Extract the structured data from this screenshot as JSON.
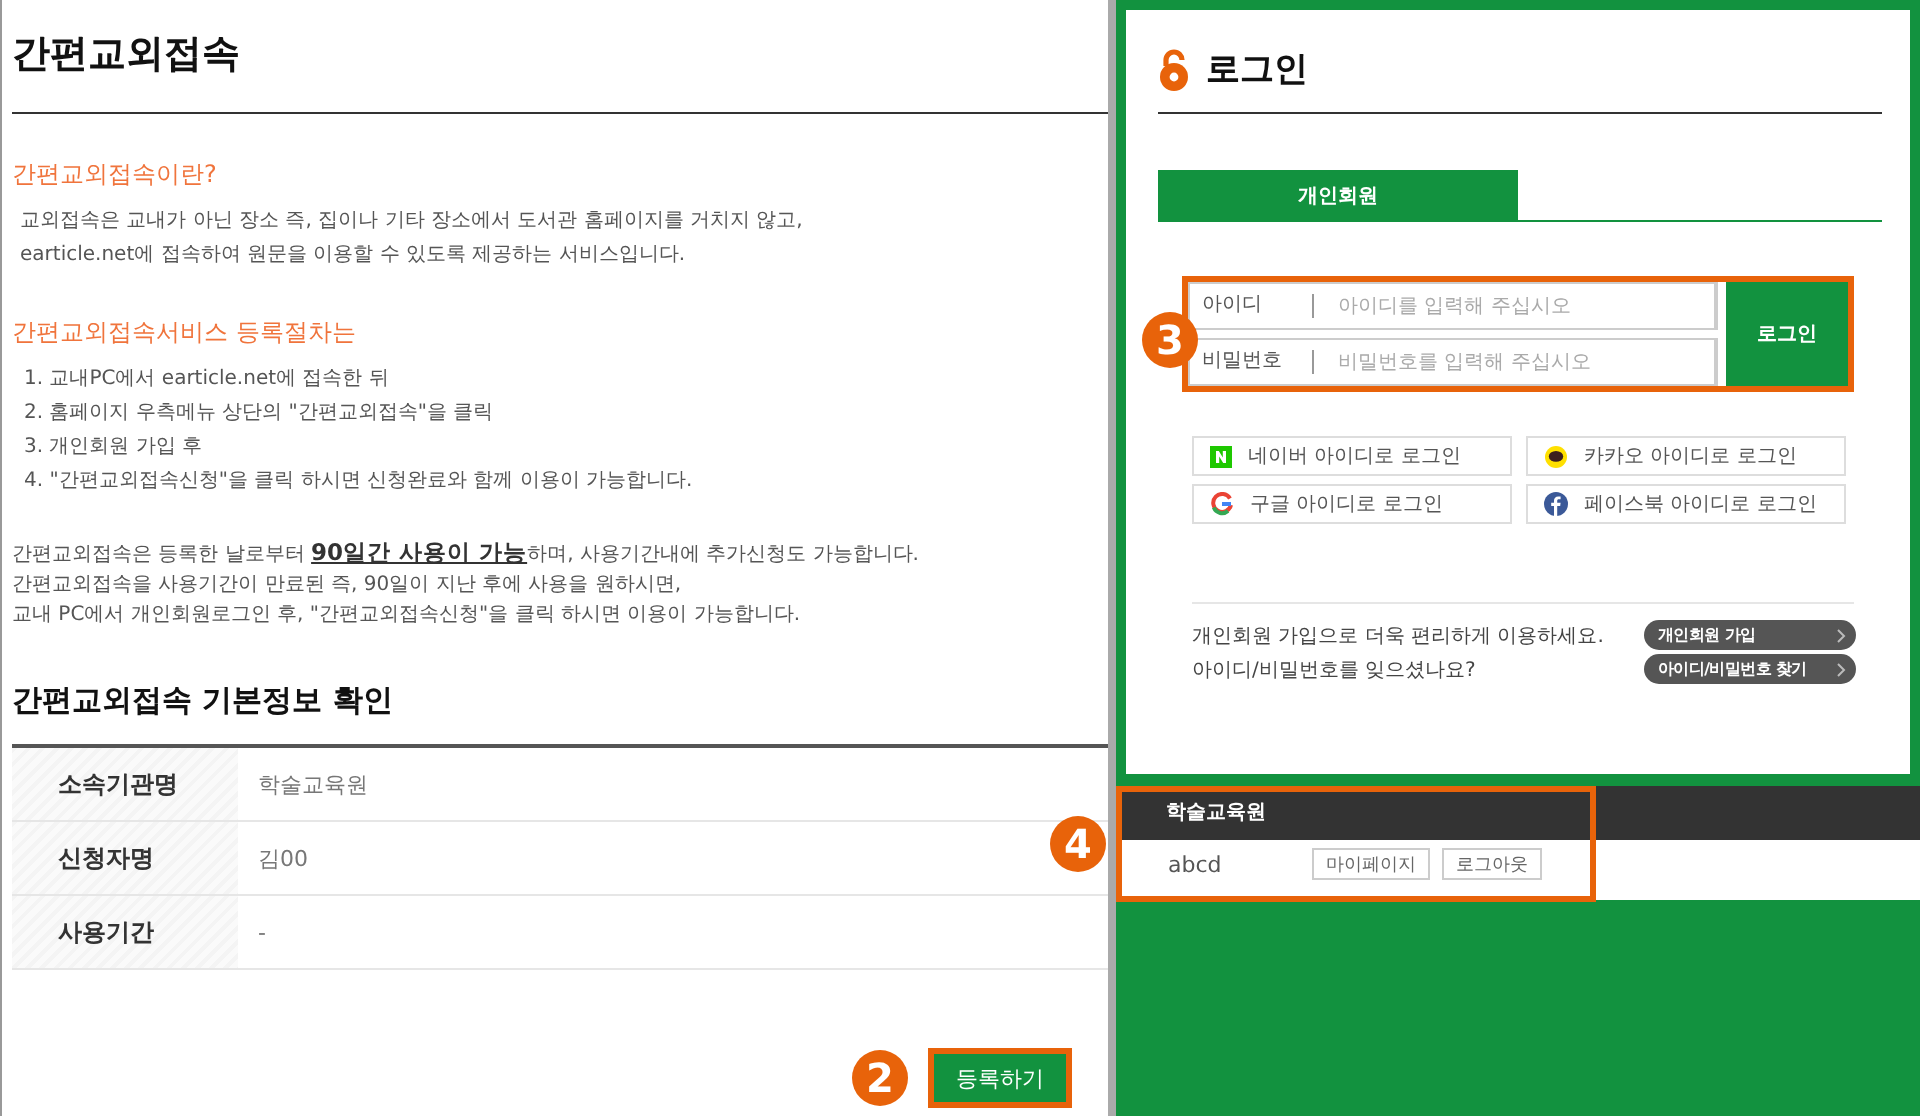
{
  "page": {
    "title": "간편교외접속"
  },
  "intro": {
    "heading": "간편교외접속이란?",
    "lines": [
      "교외접속은 교내가 아닌 장소 즉, 집이나 기타 장소에서 도서관 홈페이지를 거치지 않고,",
      "earticle.net에 접속하여 원문을 이용할 수 있도록 제공하는 서비스입니다."
    ]
  },
  "steps": {
    "heading": "간편교외접속서비스 등록절차는",
    "items": [
      "1. 교내PC에서 earticle.net에 접속한 뒤",
      "2. 홈페이지 우측메뉴 상단의 \"간편교외접속\"을 클릭",
      "3. 개인회원 가입 후",
      "4. \"간편교외접속신청\"을 클릭 하시면 신청완료와 함께 이용이 가능합니다."
    ]
  },
  "notice": [
    "간편교외접속은 등록한 날로부터 **90일간 사용이 가능**하며, 사용기간내에 추가신청도 가능합니다.",
    "간편교외접속을 사용기간이 만료된 즉, 90일이 지난 후에 사용을 원하시면,",
    "교내 PC에서 개인회원로그인 후, \"간편교외접속신청\"을 클릭 하시면 이용이 가능합니다."
  ],
  "info": {
    "heading": "간편교외접속 기본정보 확인",
    "rows": [
      {
        "label": "소속기관명",
        "value": "학술교육원"
      },
      {
        "label": "신청자명",
        "value": "김00"
      },
      {
        "label": "사용기간",
        "value": "-"
      }
    ]
  },
  "register": {
    "label": "등록하기",
    "callout": "2"
  },
  "login": {
    "title": "로그인",
    "tabs": [
      {
        "label": "개인회원",
        "selected": true
      }
    ],
    "fields": [
      {
        "label": "아이디",
        "placeholder": "아이디를 입력해 주십시오"
      },
      {
        "label": "비밀번호",
        "placeholder": "비밀번호를 입력해 주십시오"
      }
    ],
    "submit": "로그인",
    "callout": "3",
    "social": [
      {
        "kind": "naver",
        "label": "네이버 아이디로 로그인"
      },
      {
        "kind": "kakao",
        "label": "카카오 아이디로 로그인"
      },
      {
        "kind": "google",
        "label": "구글 아이디로 로그인"
      },
      {
        "kind": "facebook",
        "label": "페이스북 아이디로 로그인"
      }
    ],
    "links": [
      {
        "text": "개인회원 가입으로 더욱 편리하게 이용하세요.",
        "button": "개인회원 가입"
      },
      {
        "text": "아이디/비밀번호를 잊으셨나요?",
        "button": "아이디/비밀번호 찾기"
      }
    ]
  },
  "user_panel": {
    "institution": "학술교육원",
    "user": "abcd",
    "buttons": [
      "마이페이지",
      "로그아웃"
    ],
    "callout": "4"
  }
}
